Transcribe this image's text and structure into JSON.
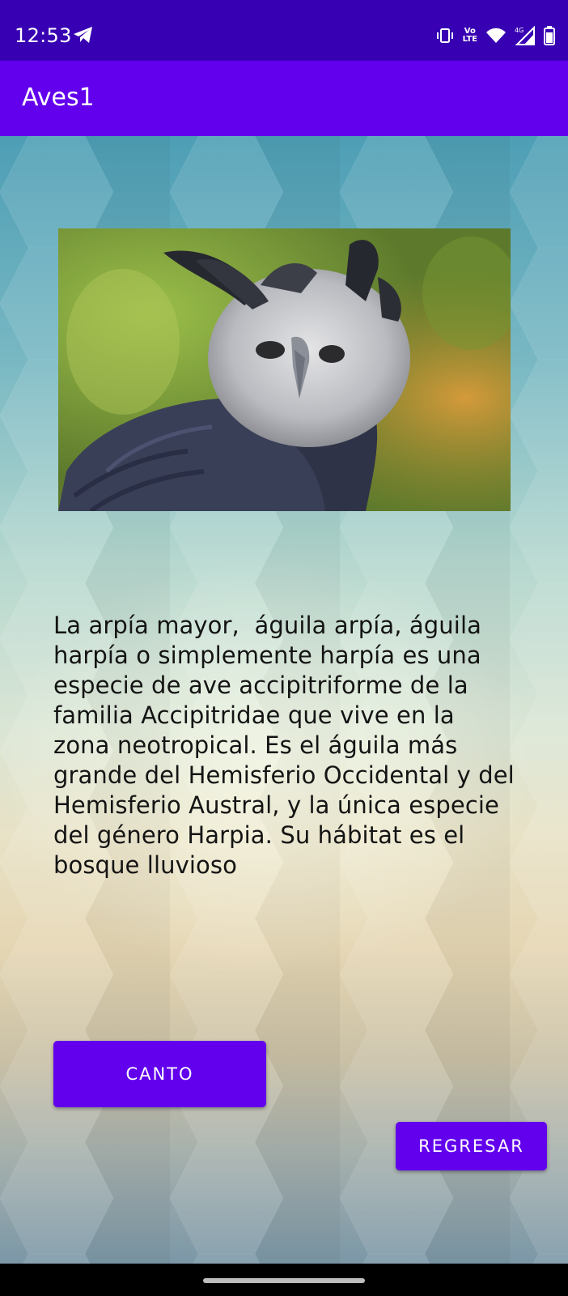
{
  "status_bar": {
    "time": "12:53",
    "icons": [
      "telegram-icon",
      "vibrate-icon",
      "volte-icon",
      "wifi-icon",
      "signal-4g-icon",
      "battery-icon"
    ],
    "volte_label": "Vo LTE",
    "network_label": "4G"
  },
  "app_bar": {
    "title": "Aves1",
    "color": "#6200EE"
  },
  "main": {
    "image_alt": "harpy-eagle-photo",
    "description": "La arpía mayor,  águila arpía, águila harpía o simplemente harpía es una especie de ave accipitriforme de la familia Accipitridae que vive en la zona neotropical. Es el águila más grande del Hemisferio Occidental y del Hemisferio Austral, y la única especie del género Harpia. Su hábitat es el bosque lluvioso",
    "buttons": {
      "canto": "CANTO",
      "regresar": "REGRESAR"
    }
  },
  "colors": {
    "status_bar": "#3700B3",
    "accent": "#6200EE"
  }
}
